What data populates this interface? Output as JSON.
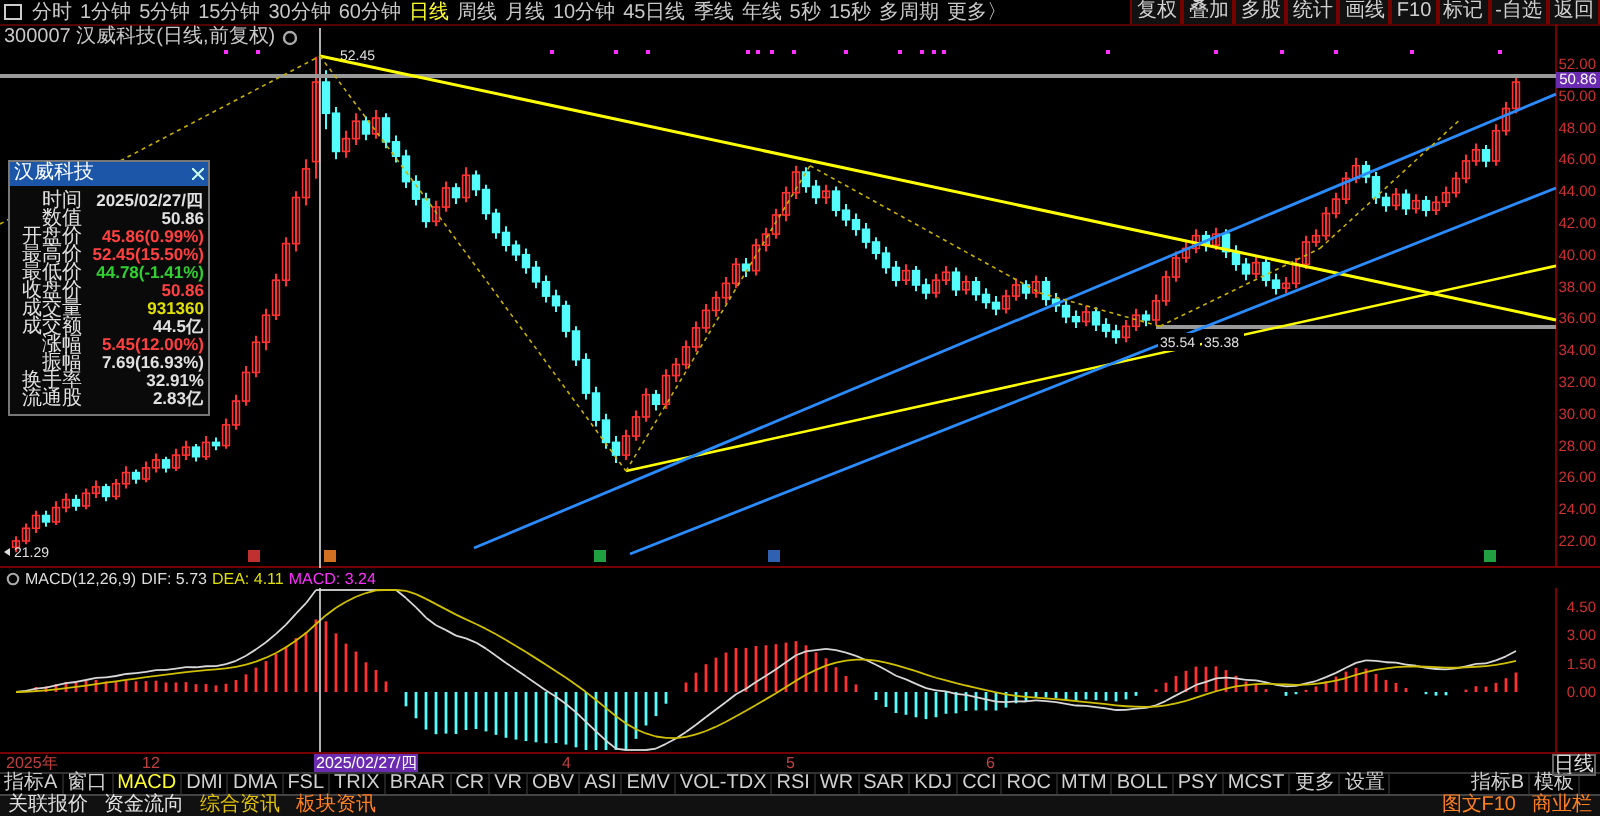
{
  "toolbar": {
    "periods": [
      {
        "label": "分时",
        "selected": false
      },
      {
        "label": "1分钟",
        "selected": false
      },
      {
        "label": "5分钟",
        "selected": false
      },
      {
        "label": "15分钟",
        "selected": false
      },
      {
        "label": "30分钟",
        "selected": false
      },
      {
        "label": "60分钟",
        "selected": false
      },
      {
        "label": "日线",
        "selected": true
      },
      {
        "label": "周线",
        "selected": false
      },
      {
        "label": "月线",
        "selected": false
      },
      {
        "label": "10分钟",
        "selected": false
      },
      {
        "label": "45日线",
        "selected": false
      },
      {
        "label": "季线",
        "selected": false
      },
      {
        "label": "年线",
        "selected": false
      },
      {
        "label": "5秒",
        "selected": false
      },
      {
        "label": "15秒",
        "selected": false
      },
      {
        "label": "多周期",
        "selected": false
      },
      {
        "label": "更多〉",
        "selected": false
      }
    ],
    "buttons": [
      "复权",
      "叠加",
      "多股",
      "统计",
      "画线",
      "F10",
      "标记",
      "-自选",
      "返回"
    ]
  },
  "title": "300007 汉威科技(日线,前复权)",
  "price_chart": {
    "chart_data": {
      "type": "candlestick",
      "ylim": [
        20.3,
        54.5
      ],
      "yticks": [
        {
          "value": 52,
          "label": "52.00"
        },
        {
          "value": 50,
          "label": "50.00"
        },
        {
          "value": 48,
          "label": "48.00"
        },
        {
          "value": 46,
          "label": "46.00"
        },
        {
          "value": 44,
          "label": "44.00"
        },
        {
          "value": 42,
          "label": "42.00"
        },
        {
          "value": 40,
          "label": "40.00"
        },
        {
          "value": 38,
          "label": "38.00"
        },
        {
          "value": 36,
          "label": "36.00"
        },
        {
          "value": 34,
          "label": "34.00"
        },
        {
          "value": 32,
          "label": "32.00"
        },
        {
          "value": 30,
          "label": "30.00"
        },
        {
          "value": 28,
          "label": "28.00"
        },
        {
          "value": 26,
          "label": "26.00"
        },
        {
          "value": 24,
          "label": "24.00"
        },
        {
          "value": 22,
          "label": "22.00"
        }
      ],
      "ohlc": [
        [
          21.6,
          22.3,
          21.29,
          22.0
        ],
        [
          22.0,
          23.1,
          21.8,
          22.8
        ],
        [
          22.8,
          23.9,
          22.5,
          23.6
        ],
        [
          23.6,
          23.9,
          22.9,
          23.2
        ],
        [
          23.2,
          24.5,
          23.0,
          24.1
        ],
        [
          24.1,
          25.0,
          23.8,
          24.6
        ],
        [
          24.6,
          24.9,
          23.9,
          24.2
        ],
        [
          24.2,
          25.3,
          24.0,
          25.0
        ],
        [
          25.0,
          25.8,
          24.7,
          25.4
        ],
        [
          25.4,
          25.6,
          24.5,
          24.8
        ],
        [
          24.8,
          25.9,
          24.6,
          25.6
        ],
        [
          25.6,
          26.7,
          25.3,
          26.3
        ],
        [
          26.3,
          26.5,
          25.6,
          25.9
        ],
        [
          25.9,
          27.0,
          25.7,
          26.6
        ],
        [
          26.6,
          27.5,
          26.3,
          27.1
        ],
        [
          27.1,
          27.3,
          26.3,
          26.6
        ],
        [
          26.6,
          27.8,
          26.4,
          27.4
        ],
        [
          27.4,
          28.3,
          27.1,
          27.9
        ],
        [
          27.9,
          28.1,
          27.0,
          27.3
        ],
        [
          27.3,
          28.6,
          27.1,
          28.2
        ],
        [
          28.2,
          28.5,
          27.7,
          28.0
        ],
        [
          28.0,
          29.7,
          27.8,
          29.3
        ],
        [
          29.3,
          31.2,
          29.0,
          30.8
        ],
        [
          30.8,
          33.0,
          30.5,
          32.6
        ],
        [
          32.6,
          34.9,
          32.3,
          34.5
        ],
        [
          34.5,
          36.6,
          34.0,
          36.2
        ],
        [
          36.2,
          38.8,
          35.9,
          38.4
        ],
        [
          38.4,
          41.1,
          38.0,
          40.7
        ],
        [
          40.7,
          44.0,
          40.2,
          43.6
        ],
        [
          43.6,
          46.0,
          43.1,
          45.4
        ],
        [
          45.86,
          52.45,
          44.78,
          50.86
        ],
        [
          50.86,
          51.6,
          47.9,
          48.9
        ],
        [
          48.9,
          49.3,
          46.0,
          46.5
        ],
        [
          46.5,
          47.8,
          46.1,
          47.3
        ],
        [
          47.3,
          48.9,
          46.9,
          48.4
        ],
        [
          48.4,
          48.7,
          47.2,
          47.6
        ],
        [
          47.6,
          49.1,
          47.3,
          48.6
        ],
        [
          48.6,
          48.9,
          46.7,
          47.1
        ],
        [
          47.1,
          47.5,
          45.8,
          46.2
        ],
        [
          46.2,
          46.6,
          44.2,
          44.6
        ],
        [
          44.6,
          45.0,
          43.1,
          43.5
        ],
        [
          43.5,
          43.9,
          41.7,
          42.1
        ],
        [
          42.1,
          43.4,
          41.8,
          43.0
        ],
        [
          43.0,
          44.6,
          42.7,
          44.2
        ],
        [
          44.2,
          44.5,
          43.2,
          43.6
        ],
        [
          43.6,
          45.5,
          43.3,
          45.0
        ],
        [
          45.0,
          45.3,
          43.7,
          44.1
        ],
        [
          44.1,
          44.4,
          42.2,
          42.6
        ],
        [
          42.6,
          42.9,
          41.0,
          41.4
        ],
        [
          41.4,
          41.8,
          40.2,
          40.6
        ],
        [
          40.6,
          40.9,
          39.6,
          40.0
        ],
        [
          40.0,
          40.4,
          38.8,
          39.2
        ],
        [
          39.2,
          39.6,
          37.9,
          38.3
        ],
        [
          38.3,
          38.7,
          37.0,
          37.4
        ],
        [
          37.4,
          37.8,
          36.4,
          36.8
        ],
        [
          36.8,
          37.1,
          34.8,
          35.2
        ],
        [
          35.2,
          35.5,
          33.0,
          33.4
        ],
        [
          33.4,
          33.8,
          30.9,
          31.3
        ],
        [
          31.3,
          31.7,
          29.2,
          29.6
        ],
        [
          29.6,
          30.0,
          27.8,
          28.2
        ],
        [
          28.2,
          28.6,
          26.9,
          27.4
        ],
        [
          27.4,
          29.0,
          27.1,
          28.6
        ],
        [
          28.6,
          30.2,
          28.3,
          29.8
        ],
        [
          29.8,
          31.6,
          29.5,
          31.2
        ],
        [
          31.2,
          31.5,
          30.2,
          30.6
        ],
        [
          30.6,
          32.8,
          30.3,
          32.4
        ],
        [
          32.4,
          33.5,
          32.0,
          33.1
        ],
        [
          33.1,
          34.6,
          32.8,
          34.2
        ],
        [
          34.2,
          35.8,
          33.9,
          35.4
        ],
        [
          35.4,
          36.9,
          35.1,
          36.5
        ],
        [
          36.5,
          37.7,
          36.1,
          37.3
        ],
        [
          37.3,
          38.6,
          36.9,
          38.2
        ],
        [
          38.2,
          39.8,
          37.9,
          39.4
        ],
        [
          39.4,
          39.8,
          38.6,
          39.0
        ],
        [
          39.0,
          41.0,
          38.7,
          40.6
        ],
        [
          40.6,
          41.7,
          40.2,
          41.3
        ],
        [
          41.3,
          42.9,
          41.0,
          42.5
        ],
        [
          42.5,
          44.3,
          42.1,
          43.9
        ],
        [
          43.9,
          45.6,
          43.5,
          45.2
        ],
        [
          45.2,
          45.5,
          43.9,
          44.3
        ],
        [
          44.3,
          44.7,
          43.2,
          43.6
        ],
        [
          43.6,
          44.4,
          43.2,
          44.0
        ],
        [
          44.0,
          44.3,
          42.4,
          42.8
        ],
        [
          42.8,
          43.2,
          41.8,
          42.2
        ],
        [
          42.2,
          42.6,
          41.2,
          41.6
        ],
        [
          41.6,
          42.0,
          40.4,
          40.8
        ],
        [
          40.8,
          41.1,
          39.7,
          40.1
        ],
        [
          40.1,
          40.5,
          38.8,
          39.2
        ],
        [
          39.2,
          39.6,
          38.0,
          38.4
        ],
        [
          38.4,
          39.4,
          38.1,
          39.0
        ],
        [
          39.0,
          39.3,
          37.7,
          38.1
        ],
        [
          38.1,
          38.5,
          37.2,
          37.6
        ],
        [
          37.6,
          38.8,
          37.3,
          38.4
        ],
        [
          38.4,
          39.3,
          38.1,
          38.9
        ],
        [
          38.9,
          39.2,
          37.4,
          37.8
        ],
        [
          37.8,
          38.7,
          37.5,
          38.3
        ],
        [
          38.3,
          38.6,
          37.1,
          37.5
        ],
        [
          37.5,
          37.9,
          36.6,
          37.0
        ],
        [
          37.0,
          37.4,
          36.2,
          36.6
        ],
        [
          36.6,
          37.8,
          36.3,
          37.4
        ],
        [
          37.4,
          38.5,
          37.1,
          38.1
        ],
        [
          38.1,
          38.4,
          37.2,
          37.6
        ],
        [
          37.6,
          38.7,
          37.3,
          38.3
        ],
        [
          38.3,
          38.6,
          36.8,
          37.2
        ],
        [
          37.2,
          37.6,
          36.4,
          36.8
        ],
        [
          36.8,
          37.2,
          35.7,
          36.1
        ],
        [
          36.1,
          36.5,
          35.4,
          35.8
        ],
        [
          35.8,
          36.8,
          35.5,
          36.4
        ],
        [
          36.4,
          36.7,
          35.2,
          35.6
        ],
        [
          35.6,
          36.0,
          34.8,
          35.2
        ],
        [
          35.2,
          35.6,
          34.4,
          34.8
        ],
        [
          34.8,
          35.9,
          34.5,
          35.5
        ],
        [
          35.5,
          36.6,
          35.2,
          36.2
        ],
        [
          36.2,
          36.5,
          35.5,
          35.9
        ],
        [
          35.9,
          37.5,
          35.6,
          37.1
        ],
        [
          37.1,
          39.0,
          36.8,
          38.6
        ],
        [
          38.6,
          40.2,
          38.3,
          39.8
        ],
        [
          39.8,
          40.8,
          39.5,
          40.4
        ],
        [
          40.4,
          41.6,
          40.1,
          41.2
        ],
        [
          41.2,
          41.5,
          40.2,
          40.6
        ],
        [
          40.6,
          41.7,
          40.3,
          41.3
        ],
        [
          41.3,
          41.6,
          39.8,
          40.2
        ],
        [
          40.2,
          40.6,
          39.0,
          39.4
        ],
        [
          39.4,
          39.8,
          38.4,
          38.8
        ],
        [
          38.8,
          39.9,
          38.5,
          39.5
        ],
        [
          39.5,
          39.8,
          38.0,
          38.4
        ],
        [
          38.4,
          38.8,
          37.5,
          37.9
        ],
        [
          37.9,
          38.6,
          37.6,
          38.2
        ],
        [
          38.2,
          39.8,
          37.9,
          39.4
        ],
        [
          39.4,
          41.2,
          39.1,
          40.8
        ],
        [
          40.8,
          41.6,
          40.5,
          41.2
        ],
        [
          41.2,
          43.0,
          40.9,
          42.6
        ],
        [
          42.6,
          43.9,
          42.3,
          43.5
        ],
        [
          43.5,
          45.2,
          43.2,
          44.8
        ],
        [
          44.8,
          46.1,
          44.5,
          45.6
        ],
        [
          45.6,
          45.9,
          44.5,
          44.9
        ],
        [
          44.9,
          45.2,
          43.2,
          43.6
        ],
        [
          43.6,
          43.9,
          42.7,
          43.1
        ],
        [
          43.1,
          44.2,
          42.8,
          43.8
        ],
        [
          43.8,
          44.1,
          42.5,
          42.9
        ],
        [
          42.9,
          43.8,
          42.6,
          43.4
        ],
        [
          43.4,
          43.7,
          42.4,
          42.8
        ],
        [
          42.8,
          43.7,
          42.5,
          43.3
        ],
        [
          43.3,
          44.3,
          43.0,
          43.9
        ],
        [
          43.9,
          45.2,
          43.6,
          44.8
        ],
        [
          44.8,
          46.3,
          44.5,
          45.9
        ],
        [
          45.9,
          47.0,
          45.6,
          46.6
        ],
        [
          46.6,
          46.9,
          45.5,
          45.9
        ],
        [
          45.9,
          48.2,
          45.6,
          47.8
        ],
        [
          47.8,
          49.6,
          47.5,
          49.2
        ],
        [
          49.2,
          51.3,
          48.9,
          50.86
        ]
      ]
    },
    "current_price": "50.86",
    "high_label": "52.45",
    "low_label": "21.29",
    "range_labels": [
      "35.54",
      "35.38"
    ]
  },
  "tooltip": {
    "title": "汉威科技",
    "rows": [
      {
        "label": "时间",
        "value": "2025/02/27/四",
        "color": "#e0e0e0"
      },
      {
        "label": "数值",
        "value": "50.86",
        "color": "#e0e0e0"
      },
      {
        "label": "开盘价",
        "value": "45.86(0.99%)",
        "color": "#ff4040"
      },
      {
        "label": "最高价",
        "value": "52.45(15.50%)",
        "color": "#ff4040"
      },
      {
        "label": "最低价",
        "value": "44.78(-1.41%)",
        "color": "#30d030"
      },
      {
        "label": "收盘价",
        "value": "50.86",
        "color": "#ff4040"
      },
      {
        "label": "成交量",
        "value": "931360",
        "color": "#e0e000"
      },
      {
        "label": "成交额",
        "value": "44.5亿",
        "color": "#e0e0e0"
      },
      {
        "label": "涨幅",
        "value": "5.45(12.00%)",
        "color": "#ff4040"
      },
      {
        "label": "振幅",
        "value": "7.69(16.93%)",
        "color": "#e0e0e0"
      },
      {
        "label": "换手率",
        "value": "32.91%",
        "color": "#e0e0e0"
      },
      {
        "label": "流通股",
        "value": "2.83亿",
        "color": "#e0e0e0"
      }
    ]
  },
  "macd": {
    "name": "MACD(12,26,9)",
    "dif": "DIF: 5.73",
    "dea": "DEA: 4.11",
    "macd": "MACD: 3.24",
    "axis_labels": [
      "4.50",
      "3.00",
      "1.50",
      "0.00"
    ]
  },
  "date_axis": [
    {
      "label": "2025年",
      "selected": false
    },
    {
      "label": "12",
      "selected": false
    },
    {
      "label": "2025/02/27/四",
      "selected": true
    },
    {
      "label": "4",
      "selected": false
    },
    {
      "label": "5",
      "selected": false
    },
    {
      "label": "6",
      "selected": false
    }
  ],
  "period_label": "日线",
  "indicator_tabs": [
    {
      "label": "指标A",
      "selected": false
    },
    {
      "label": "窗口",
      "selected": false
    },
    {
      "label": "MACD",
      "selected": true
    },
    {
      "label": "DMI",
      "selected": false
    },
    {
      "label": "DMA",
      "selected": false
    },
    {
      "label": "FSL",
      "selected": false
    },
    {
      "label": "TRIX",
      "selected": false
    },
    {
      "label": "BRAR",
      "selected": false
    },
    {
      "label": "CR",
      "selected": false
    },
    {
      "label": "VR",
      "selected": false
    },
    {
      "label": "OBV",
      "selected": false
    },
    {
      "label": "ASI",
      "selected": false
    },
    {
      "label": "EMV",
      "selected": false
    },
    {
      "label": "VOL-TDX",
      "selected": false
    },
    {
      "label": "RSI",
      "selected": false
    },
    {
      "label": "WR",
      "selected": false
    },
    {
      "label": "SAR",
      "selected": false
    },
    {
      "label": "KDJ",
      "selected": false
    },
    {
      "label": "CCI",
      "selected": false
    },
    {
      "label": "ROC",
      "selected": false
    },
    {
      "label": "MTM",
      "selected": false
    },
    {
      "label": "BOLL",
      "selected": false
    },
    {
      "label": "PSY",
      "selected": false
    },
    {
      "label": "MCST",
      "selected": false
    },
    {
      "label": "更多",
      "selected": false
    },
    {
      "label": "设置",
      "selected": false
    }
  ],
  "indicator_buttons": [
    "指标B",
    "模板"
  ],
  "bottom_tabs": [
    {
      "label": "关联报价",
      "color": "#e0e0e0"
    },
    {
      "label": "资金流向",
      "color": "#e0e0e0"
    },
    {
      "label": "综合资讯",
      "color": "#e0c000"
    },
    {
      "label": "板块资讯",
      "color": "#ff8020"
    }
  ],
  "bottom_right": [
    "图文F10",
    "商业栏"
  ]
}
